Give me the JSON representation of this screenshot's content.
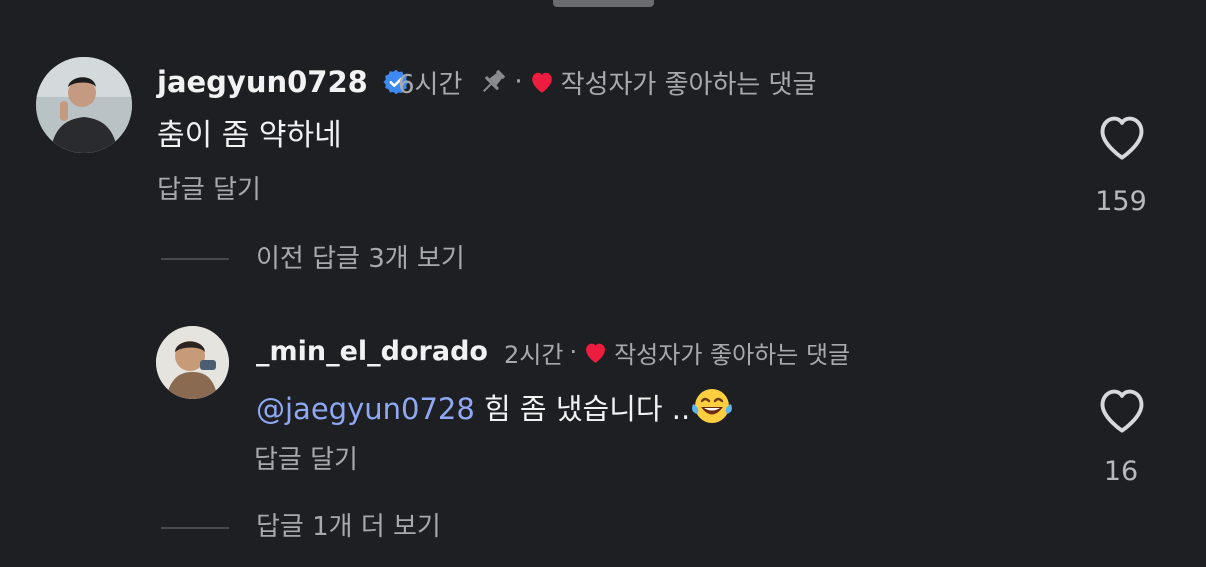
{
  "comments": [
    {
      "username": "jaegyun0728",
      "verified": true,
      "time": "6시간",
      "pinned": true,
      "separator": "·",
      "creator_liked_label": "작성자가 좋아하는 댓글",
      "text": "춤이 좀 약하네",
      "reply_label": "답글 달기",
      "like_count": "159"
    }
  ],
  "previous_replies_label": "이전 답글 3개 보기",
  "replies": [
    {
      "username": "_min_el_dorado",
      "time": "2시간",
      "separator": "·",
      "creator_liked_label": "작성자가 좋아하는 댓글",
      "mention": "@jaegyun0728",
      "text": "힘 좀 냈습니다 ..",
      "emoji": "😂",
      "reply_label": "답글 달기",
      "like_count": "16"
    }
  ],
  "more_replies_label": "답글 1개 더 보기",
  "colors": {
    "background": "#1e1f22",
    "heart_red": "#ee1d3f",
    "verified_blue": "#3d8bf2",
    "mention_blue": "#8fa8f2"
  },
  "icons": [
    "verified-badge-icon",
    "pin-icon",
    "heart-filled-icon",
    "heart-outline-icon",
    "laughing-emoji-icon"
  ]
}
